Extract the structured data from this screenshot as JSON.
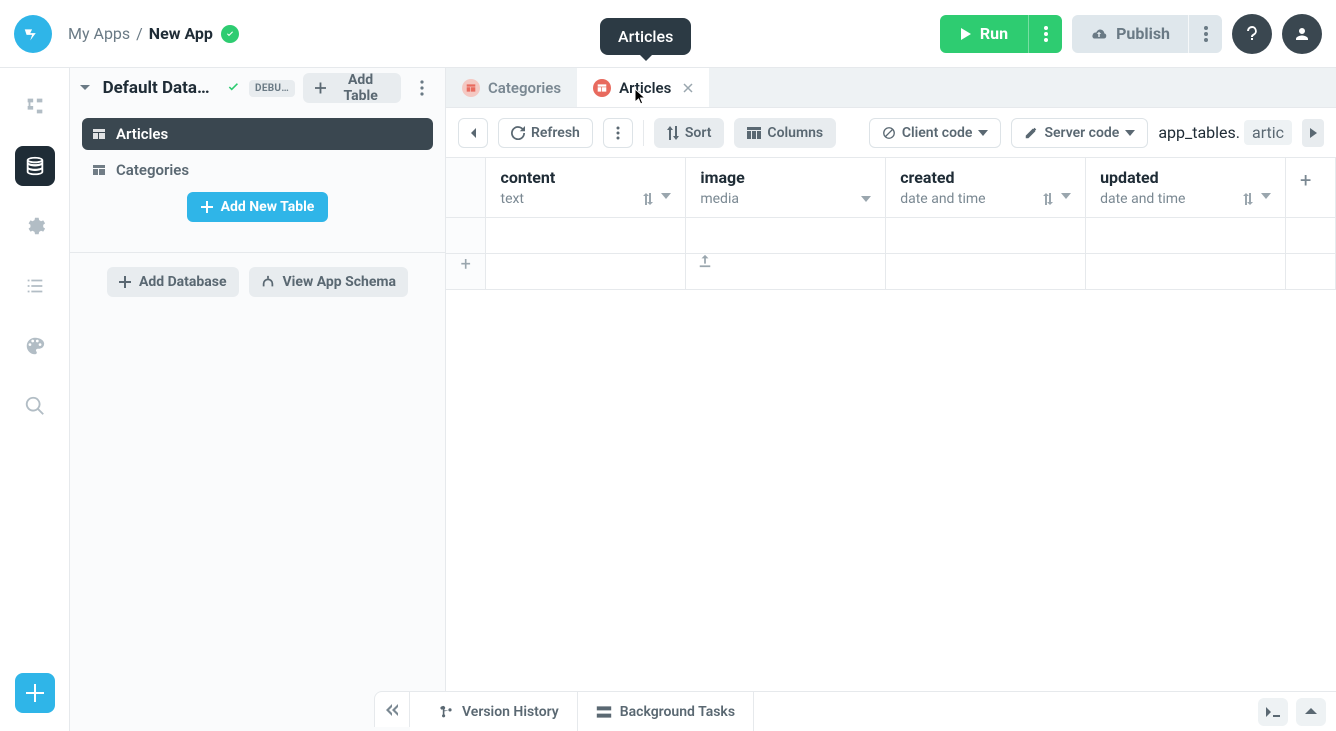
{
  "breadcrumb": {
    "parent": "My Apps",
    "current": "New App"
  },
  "topbar": {
    "run": "Run",
    "publish": "Publish"
  },
  "tooltip": "Articles",
  "sidebar": {
    "db_title": "Default Databa…",
    "debug_tag": "DEBU…",
    "add_table": "Add Table",
    "tables": [
      {
        "name": "Articles",
        "active": true
      },
      {
        "name": "Categories",
        "active": false
      }
    ],
    "add_new_table": "Add New Table",
    "add_database": "Add Database",
    "view_schema": "View App Schema"
  },
  "tabs": [
    {
      "id": "categories",
      "label": "Categories",
      "active": false
    },
    {
      "id": "articles",
      "label": "Articles",
      "active": true,
      "closable": true
    }
  ],
  "toolbar": {
    "refresh": "Refresh",
    "sort": "Sort",
    "columns": "Columns",
    "client_code": "Client code",
    "server_code": "Server code",
    "code_prefix": "app_tables.",
    "code_token": "artic"
  },
  "columns": [
    {
      "name": "content",
      "type": "text",
      "sortable": true
    },
    {
      "name": "image",
      "type": "media",
      "sortable": false
    },
    {
      "name": "created",
      "type": "date and time",
      "sortable": true
    },
    {
      "name": "updated",
      "type": "date and time",
      "sortable": true
    }
  ],
  "bottombar": {
    "version_history": "Version History",
    "background_tasks": "Background Tasks"
  }
}
